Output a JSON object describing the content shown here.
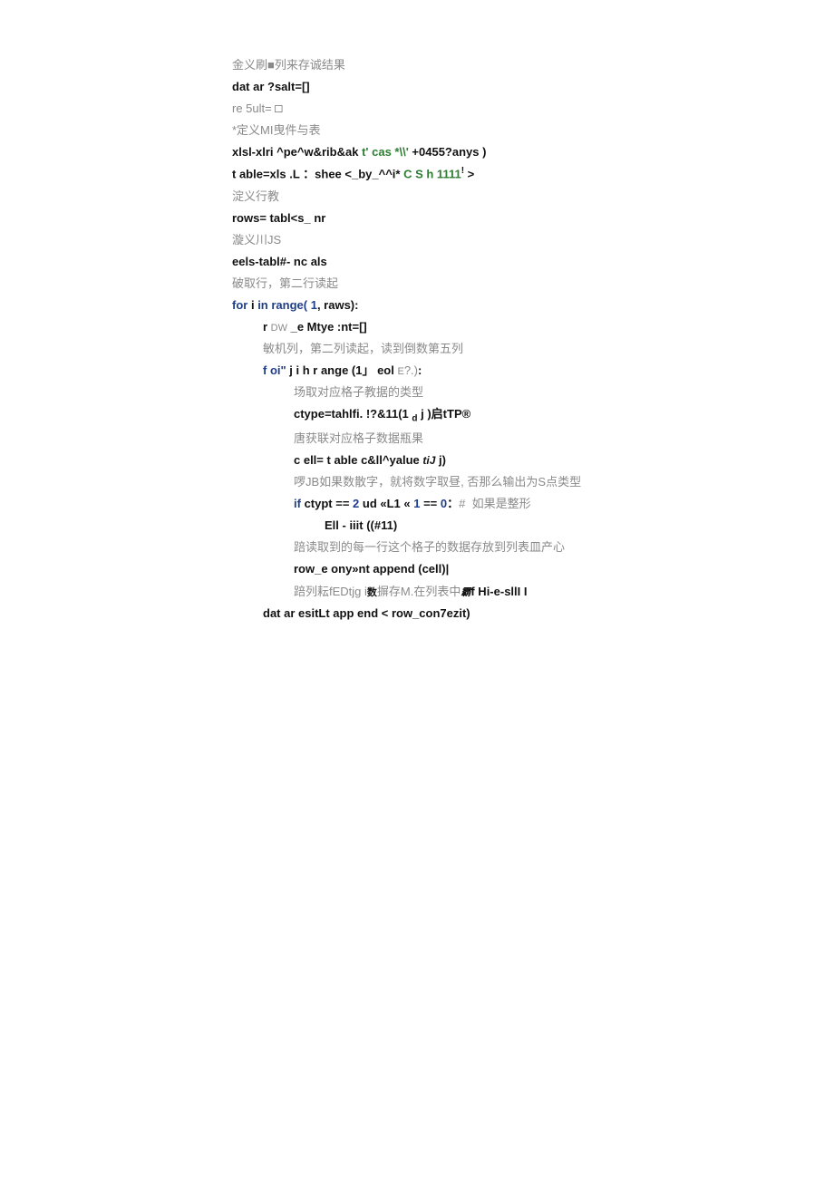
{
  "lines": {
    "c0": "金义刷■列来存诚结果",
    "l1_a": "dat ar ?salt=[]",
    "l2_a": "re 5ult=",
    "l2_b": " □",
    "c1": "*定义MI曳件与表",
    "l3_a": "xlsl-xlri ^pe^w&rib&ak ",
    "l3_b": "t' cas *\\\\'",
    "l3_c": " +0455?anys )",
    "l4_a": "t able=xls .L ：shee <_by_^^i* ",
    "l4_b": "C S h 1111",
    "l4_c": "!",
    "l4_d": " >",
    "c2": "淀义行教",
    "l5_a": "rows= tabl<s_ nr",
    "c3": "漩义川JS",
    "l6_a": "eels-tabl#- nc als",
    "c4": "破取行，第二行读起",
    "l7_a": "for",
    "l7_b": " i ",
    "l7_c": "in",
    "l7_d": " range( ",
    "l7_e": "1",
    "l7_f": ", raws):",
    "l8_a": "r ",
    "l8_b": "DW",
    "l8_c": " _e Mtye :nt=[]",
    "c5": "敏机列，第二列读起，读到倒数第五列",
    "l9_a": "f oi\"",
    "l9_b": " j i h r ange (1」 eol ",
    "l9_c": "E",
    "l9_d": "?.)",
    "l9_e": ":",
    "c6": "场取对应格子教据的类型",
    "l10_a": "ctype=tahlfi. !?&11(1 ",
    "l10_b": "d",
    "l10_c": " j )启tTP®",
    "c7": "唐获联对应格子数据瓶果",
    "l11_a": "c ell= t able c&ll^yalue ",
    "l11_b": "tiJ",
    "l11_c": " j)",
    "c8": "啰JB如果数散字，就将数字取昼, 否那么输出为S点类型",
    "l12_a": "if",
    "l12_b": " ctypt == ",
    "l12_c": "2",
    "l12_d": " ud «L1 « ",
    "l12_e": "1",
    "l12_f": " == ",
    "l12_g": "0",
    "l12_h": "：",
    "l12_i": "#  如果是整形",
    "l13_a": "Ell - iiit ((#11)",
    "c9": "踣读取到的每一行这个格子的数据存放到列表皿产心",
    "l14_a": "row_e ony»nt append (cell)|",
    "c10_a": "踣列耘fEDtjg i",
    "c10_b": "数",
    "c10_c": "摒存M.在列表中",
    "c10_d": "霸",
    "c10_e": "f Hi-e-sllI I",
    "l15_a": "dat ar esitLt app end < row_con7ezit)"
  }
}
